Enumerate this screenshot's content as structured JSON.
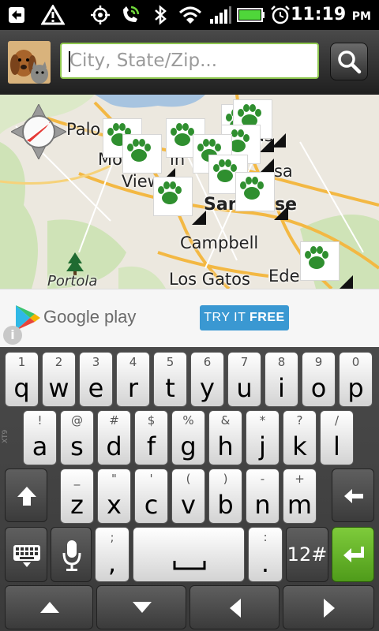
{
  "status_bar": {
    "time": "11:19",
    "ampm": "PM",
    "icons": [
      "usb-debug-icon",
      "warning-icon",
      "gps-icon",
      "phone-wifi-call-icon",
      "bluetooth-icon",
      "wifi-icon",
      "signal-icon",
      "battery-icon",
      "alarm-icon"
    ]
  },
  "search": {
    "placeholder": "City, State/Zip...",
    "value": "",
    "button_icon": "search-icon"
  },
  "map": {
    "labels": {
      "palo_alto": "Palo",
      "mountain_view": "Mo",
      "view": "View",
      "san_jose": "San",
      "jose": "se",
      "campbell": "Campbell",
      "los_gatos": "Los Gatos",
      "edenvale": "Ede",
      "portola": "Portola",
      "santa_clara_frag": "ssa",
      "tas": "as",
      "in": "in"
    },
    "marker_icon": "paw-print-icon",
    "compass_icon": "compass-icon"
  },
  "ad": {
    "brand": "Google play",
    "cta_prefix": "TRY IT",
    "cta_bold": "FREE",
    "info": "i"
  },
  "keyboard": {
    "row1": [
      {
        "main": "q",
        "alt": "1"
      },
      {
        "main": "w",
        "alt": "2"
      },
      {
        "main": "e",
        "alt": "3"
      },
      {
        "main": "r",
        "alt": "4"
      },
      {
        "main": "t",
        "alt": "5"
      },
      {
        "main": "y",
        "alt": "6"
      },
      {
        "main": "u",
        "alt": "7"
      },
      {
        "main": "i",
        "alt": "8"
      },
      {
        "main": "o",
        "alt": "9"
      },
      {
        "main": "p",
        "alt": "0"
      }
    ],
    "row2": [
      {
        "main": "a",
        "alt": "!"
      },
      {
        "main": "s",
        "alt": "@"
      },
      {
        "main": "d",
        "alt": "#"
      },
      {
        "main": "f",
        "alt": "$"
      },
      {
        "main": "g",
        "alt": "%"
      },
      {
        "main": "h",
        "alt": "&"
      },
      {
        "main": "j",
        "alt": "*"
      },
      {
        "main": "k",
        "alt": "?"
      },
      {
        "main": "l",
        "alt": "/"
      }
    ],
    "row3": [
      {
        "main": "z",
        "alt": "_"
      },
      {
        "main": "x",
        "alt": "\""
      },
      {
        "main": "c",
        "alt": "'"
      },
      {
        "main": "v",
        "alt": "("
      },
      {
        "main": "b",
        "alt": ")"
      },
      {
        "main": "n",
        "alt": "-"
      },
      {
        "main": "m",
        "alt": "+"
      }
    ],
    "row4": {
      "comma": ",",
      "comma_alt": ";",
      "period": ".",
      "period_alt": ":",
      "numbers": "12#"
    },
    "side_label": "XT9"
  }
}
